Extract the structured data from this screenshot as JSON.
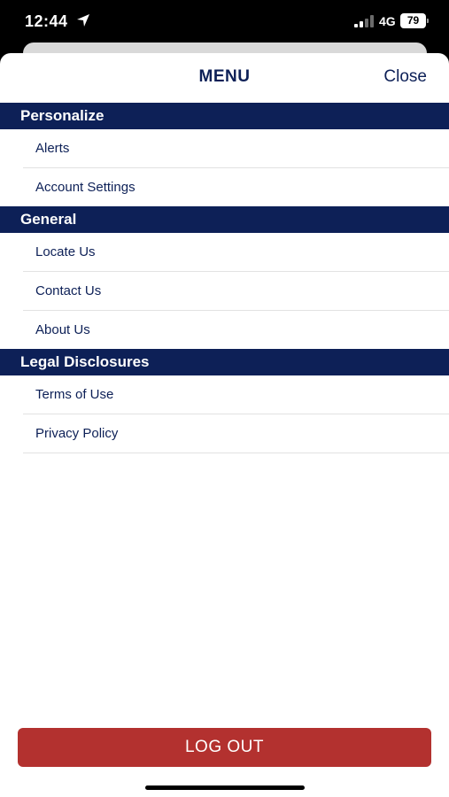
{
  "status_bar": {
    "time": "12:44",
    "network": "4G",
    "battery": "79",
    "icons": [
      "location-arrow-icon",
      "signal-icon",
      "battery-icon"
    ]
  },
  "header": {
    "title": "MENU",
    "close_label": "Close"
  },
  "sections": [
    {
      "title": "Personalize",
      "items": [
        "Alerts",
        "Account Settings"
      ]
    },
    {
      "title": "General",
      "items": [
        "Locate Us",
        "Contact Us",
        "About Us"
      ]
    },
    {
      "title": "Legal Disclosures",
      "items": [
        "Terms of Use",
        "Privacy Policy"
      ]
    }
  ],
  "footer": {
    "logout_label": "LOG OUT"
  },
  "colors": {
    "navy": "#0d2057",
    "logout_red": "#b3312f",
    "divider": "#e2e2e2"
  }
}
